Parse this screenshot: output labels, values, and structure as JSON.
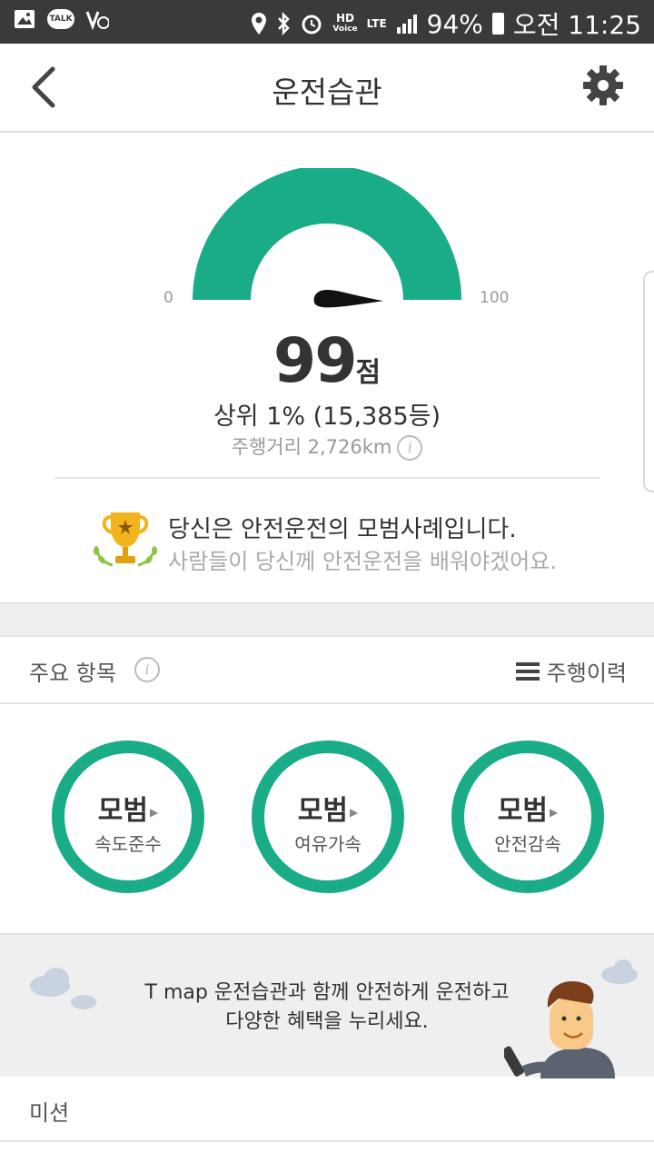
{
  "status_bar": {
    "talk": "TALK",
    "hd": "HD",
    "voice": "Voice",
    "lte": "LTE",
    "battery": "94%",
    "time": "오전 11:25"
  },
  "header": {
    "title": "운전습관"
  },
  "gauge": {
    "min": "0",
    "max": "100",
    "value": 99
  },
  "score": {
    "number": "99",
    "unit": "점"
  },
  "rank": "상위 1% (15,385등)",
  "distance": "주행거리 2,726km",
  "message": {
    "line1": "당신은 안전운전의 모범사례입니다.",
    "line2": "사람들이 당신께 안전운전을 배워야겠어요."
  },
  "items": {
    "title": "주요 항목",
    "history_label": "주행이력",
    "list": [
      {
        "grade": "모범",
        "label": "속도준수"
      },
      {
        "grade": "모범",
        "label": "여유가속"
      },
      {
        "grade": "모범",
        "label": "안전감속"
      }
    ]
  },
  "banner": {
    "line1": "T map 운전습관과 함께 안전하게 운전하고",
    "line2": "다양한 혜택을 누리세요."
  },
  "mission": {
    "label": "미션"
  },
  "colors": {
    "accent": "#19ac86",
    "statusbar": "#3a3a3a"
  }
}
